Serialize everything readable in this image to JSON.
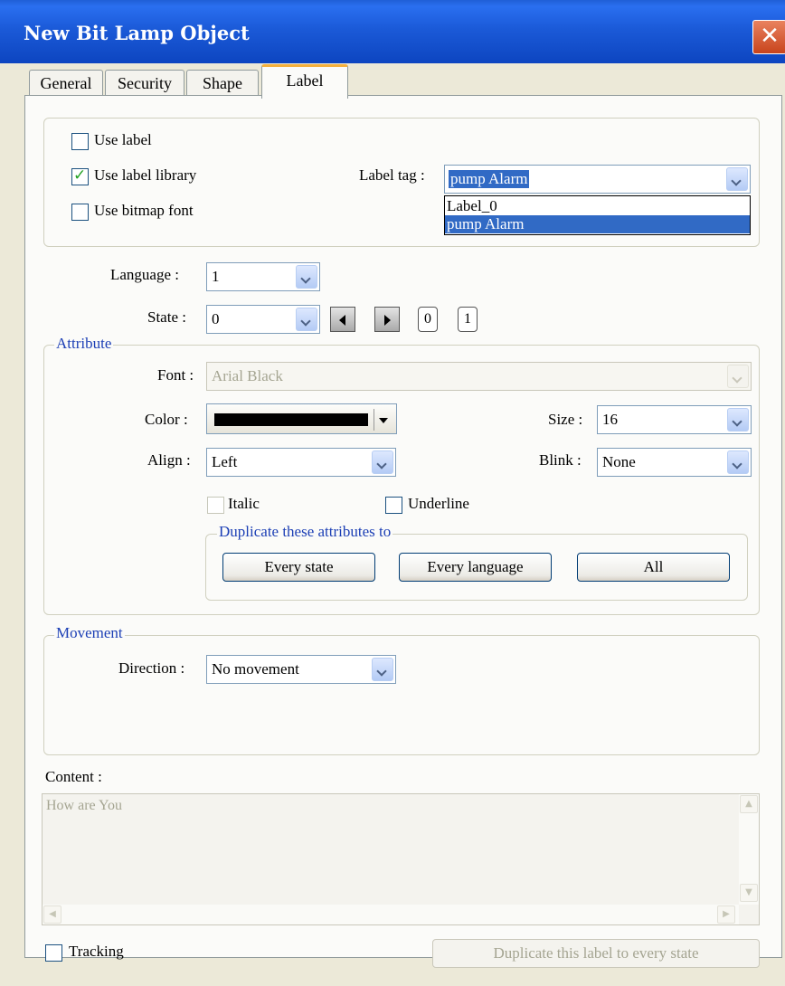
{
  "window": {
    "title": "New  Bit Lamp Object",
    "close_glyph": "✕"
  },
  "tabs": [
    {
      "label": "General"
    },
    {
      "label": "Security"
    },
    {
      "label": "Shape"
    },
    {
      "label": "Label",
      "active": true
    }
  ],
  "label_options": {
    "use_label": {
      "label": "Use label",
      "checked": false
    },
    "use_label_library": {
      "label": "Use label library",
      "checked": true
    },
    "use_bitmap_font": {
      "label": "Use bitmap font",
      "checked": false
    },
    "label_tag_caption": "Label tag :",
    "label_tag_value": "pump Alarm",
    "label_tag_options": [
      "Label_0",
      "pump Alarm"
    ]
  },
  "language": {
    "caption": "Language :",
    "value": "1"
  },
  "state": {
    "caption": "State :",
    "value": "0",
    "quick_buttons": [
      "0",
      "1"
    ]
  },
  "attribute": {
    "legend": "Attribute",
    "font_caption": "Font :",
    "font_value": "Arial Black",
    "color_caption": "Color :",
    "color_value": "#000000",
    "size_caption": "Size :",
    "size_value": "16",
    "align_caption": "Align :",
    "align_value": "Left",
    "blink_caption": "Blink :",
    "blink_value": "None",
    "italic_label": "Italic",
    "underline_label": "Underline",
    "duplicate_legend": "Duplicate these attributes to",
    "buttons": [
      "Every state",
      "Every language",
      "All"
    ]
  },
  "movement": {
    "legend": "Movement",
    "direction_caption": "Direction :",
    "direction_value": "No movement"
  },
  "content": {
    "caption": "Content :",
    "text": "How are You"
  },
  "footer": {
    "tracking_label": "Tracking",
    "duplicate_button": "Duplicate this label to every state"
  },
  "colors": {
    "titlebar": "#0d45c0",
    "active_tab_accent": "#f5b03c",
    "legend_text": "#1c3fb5",
    "selection": "#316ac5",
    "close_button": "#c8441c"
  }
}
